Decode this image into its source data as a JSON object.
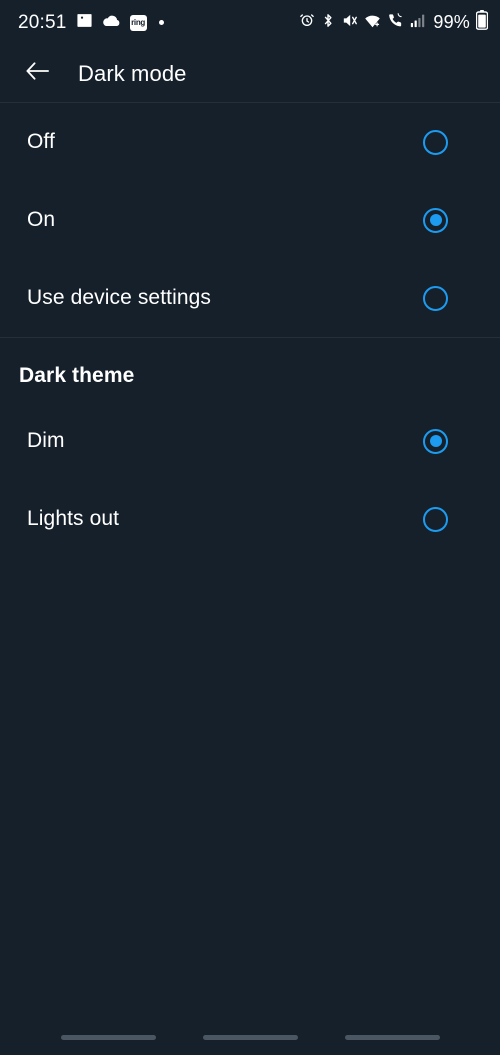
{
  "theme": {
    "background": "#15202b",
    "accent": "#1d9bf0",
    "text": "#ffffff",
    "divider": "#22303c",
    "nav_pill": "#4a5763"
  },
  "status_bar": {
    "clock": "20:51",
    "ring_badge_label": "ring",
    "battery_percent": "99%",
    "left_icons": [
      "image-icon",
      "cloud-icon",
      "ring-app-badge-icon",
      "notification-dot-icon"
    ],
    "right_icons": [
      "alarm-icon",
      "bluetooth-icon",
      "mute-icon",
      "wifi-icon",
      "call-icon",
      "cellular-signal-icon",
      "battery-icon"
    ]
  },
  "app_bar": {
    "back_icon": "back-arrow-icon",
    "title": "Dark mode"
  },
  "dark_mode_options": [
    {
      "label": "Off",
      "selected": false
    },
    {
      "label": "On",
      "selected": true
    },
    {
      "label": "Use device settings",
      "selected": false
    }
  ],
  "dark_theme_section": {
    "header": "Dark theme",
    "options": [
      {
        "label": "Dim",
        "selected": true
      },
      {
        "label": "Lights out",
        "selected": false
      }
    ]
  },
  "nav_bar": {
    "items": [
      "recents-pill",
      "home-pill",
      "back-pill"
    ]
  }
}
